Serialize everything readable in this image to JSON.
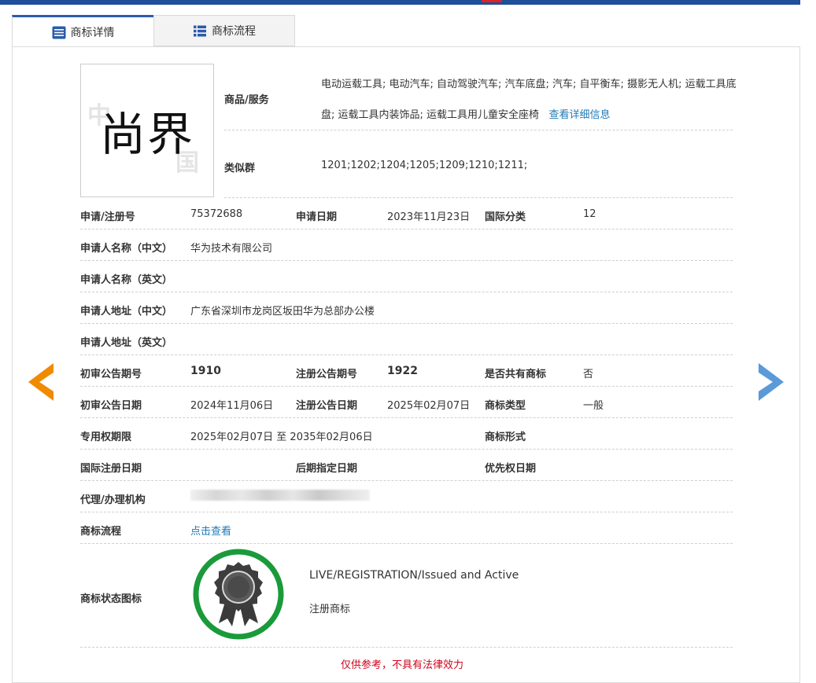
{
  "colors": {
    "accent": "#2a5caa",
    "link": "#1e7ab8",
    "warning": "#d0021b",
    "badge_ring": "#1a9a3a",
    "prev_arrow": "#f08a00",
    "next_arrow": "#5a9ad8"
  },
  "tabs": [
    {
      "label": "商标详情",
      "icon": "list-doc-icon",
      "active": true
    },
    {
      "label": "商标流程",
      "icon": "list-bullets-icon",
      "active": false
    }
  ],
  "trademark": {
    "mark_text": "尚界"
  },
  "goods": {
    "label": "商品/服务",
    "text": "电动运载工具; 电动汽车; 自动驾驶汽车; 汽车底盘; 汽车; 自平衡车; 摄影无人机; 运载工具底盘; 运载工具内装饰品; 运载工具用儿童安全座椅",
    "more_link": "查看详细信息"
  },
  "similar_group": {
    "label": "类似群",
    "value": "1201;1202;1204;1205;1209;1210;1211;"
  },
  "fields": {
    "reg_no_label": "申请/注册号",
    "reg_no": "75372688",
    "app_date_label": "申请日期",
    "app_date": "2023年11月23日",
    "intl_class_label": "国际分类",
    "intl_class": "12",
    "applicant_cn_label": "申请人名称（中文）",
    "applicant_cn": "华为技术有限公司",
    "applicant_en_label": "申请人名称（英文）",
    "applicant_en": "",
    "address_cn_label": "申请人地址（中文）",
    "address_cn": "广东省深圳市龙岗区坂田华为总部办公楼",
    "address_en_label": "申请人地址（英文）",
    "address_en": "",
    "prelim_no_label": "初审公告期号",
    "prelim_no": "1910",
    "reg_pub_no_label": "注册公告期号",
    "reg_pub_no": "1922",
    "shared_label": "是否共有商标",
    "shared": "否",
    "prelim_date_label": "初审公告日期",
    "prelim_date": "2024年11月06日",
    "reg_pub_date_label": "注册公告日期",
    "reg_pub_date": "2025年02月07日",
    "mark_type_label": "商标类型",
    "mark_type": "一般",
    "exclusive_label": "专用权期限",
    "exclusive": "2025年02月07日 至 2035年02月06日",
    "mark_form_label": "商标形式",
    "mark_form": "",
    "intl_reg_label": "国际注册日期",
    "intl_reg": "",
    "later_label": "后期指定日期",
    "later": "",
    "priority_label": "优先权日期",
    "priority": "",
    "agent_label": "代理/办理机构",
    "process_label": "商标流程",
    "process_link": "点击查看",
    "status_icon_label": "商标状态图标",
    "status_en": "LIVE/REGISTRATION/Issued and Active",
    "status_cn": "注册商标"
  },
  "footer_note": "仅供参考，不具有法律效力",
  "nav": {
    "prev_icon": "chevron-left-icon",
    "next_icon": "chevron-right-icon"
  }
}
